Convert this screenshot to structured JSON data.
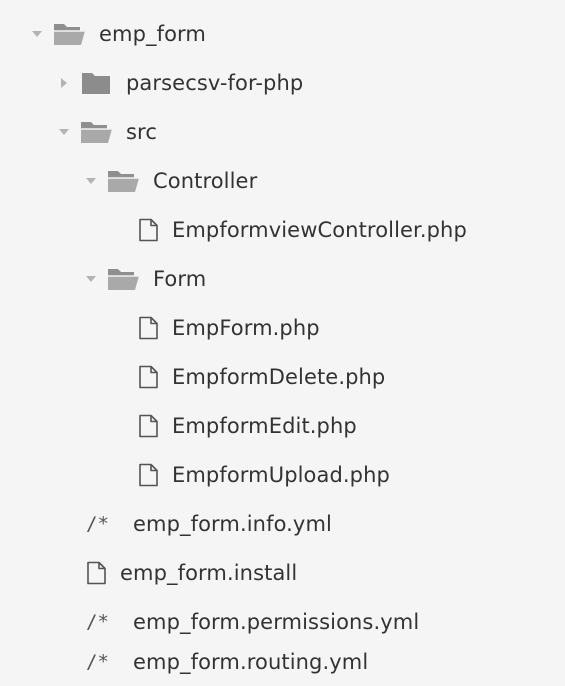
{
  "tree": {
    "root": {
      "label": "emp_form",
      "icon": "folder-open-icon",
      "expanded": true
    },
    "parsecsv": {
      "label": "parsecsv-for-php",
      "icon": "folder-closed-icon",
      "expanded": false
    },
    "src": {
      "label": "src",
      "icon": "folder-open-icon",
      "expanded": true
    },
    "controller": {
      "label": "Controller",
      "icon": "folder-open-icon",
      "expanded": true
    },
    "controller_file": {
      "label": "EmpformviewController.php",
      "icon": "file-icon"
    },
    "form": {
      "label": "Form",
      "icon": "folder-open-icon",
      "expanded": true
    },
    "form_files": [
      {
        "label": "EmpForm.php",
        "icon": "file-icon"
      },
      {
        "label": "EmpformDelete.php",
        "icon": "file-icon"
      },
      {
        "label": "EmpformEdit.php",
        "icon": "file-icon"
      },
      {
        "label": "EmpformUpload.php",
        "icon": "file-icon"
      }
    ],
    "info_yml": {
      "label": "emp_form.info.yml",
      "glyph": "/*"
    },
    "install": {
      "label": "emp_form.install",
      "icon": "file-icon"
    },
    "permissions_yml": {
      "label": "emp_form.permissions.yml",
      "glyph": "/*"
    },
    "routing_yml": {
      "label": "emp_form.routing.yml",
      "glyph": "/*"
    }
  },
  "colors": {
    "background": "#f5f5f5",
    "text": "#333333",
    "twisty": "#b3b3b3",
    "folder": "#9a9a9a"
  }
}
